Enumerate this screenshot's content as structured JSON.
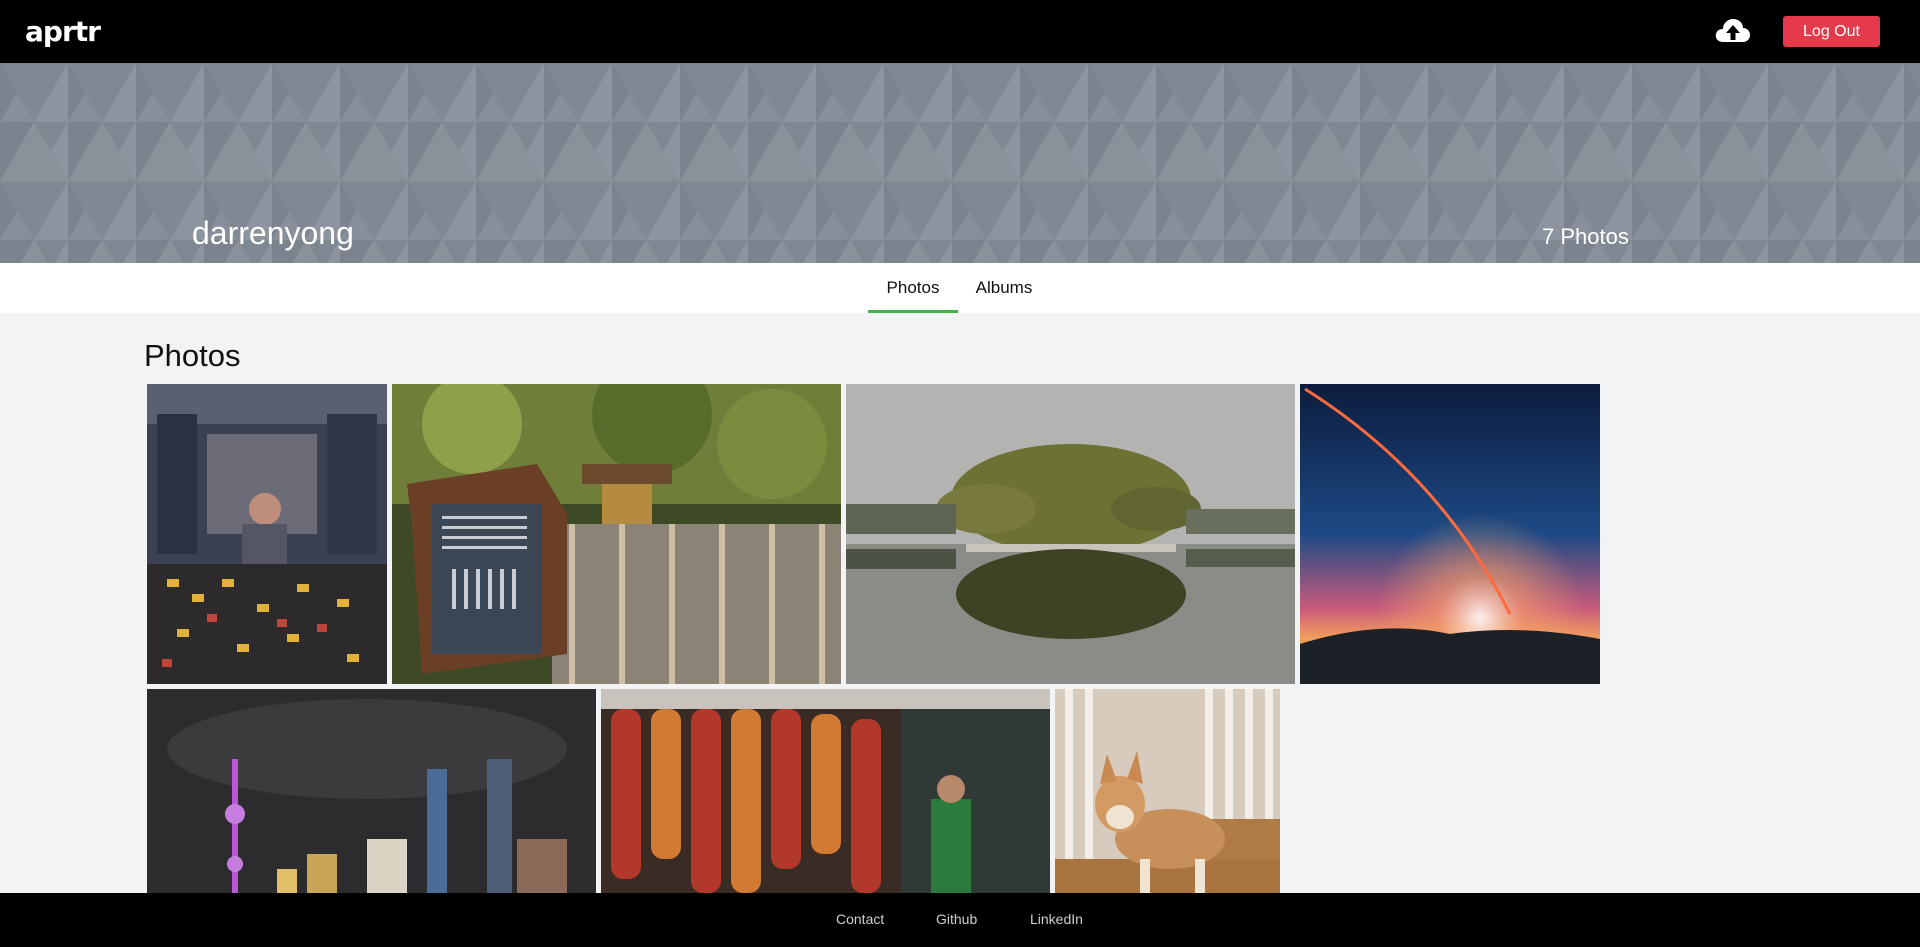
{
  "header": {
    "logo": "aprtr",
    "upload_icon": "cloud-upload-icon",
    "logout_label": "Log Out",
    "logout_color": "#e53a4c"
  },
  "profile": {
    "username": "darrenyong",
    "photo_count": "7 Photos"
  },
  "tabs": [
    {
      "label": "Photos",
      "active": true
    },
    {
      "label": "Albums",
      "active": false
    }
  ],
  "section_title": "Photos",
  "photos": [
    {
      "subject": "shop-keeper-market"
    },
    {
      "subject": "garden-shrine-sign"
    },
    {
      "subject": "lake-tree-reflection"
    },
    {
      "subject": "rocket-launch-night"
    },
    {
      "subject": "city-skyline-night"
    },
    {
      "subject": "hanging-chili-peppers"
    },
    {
      "subject": "shiba-inu-dog"
    }
  ],
  "footer": {
    "links": [
      "Contact",
      "Github",
      "LinkedIn"
    ]
  },
  "colors": {
    "accent": "#3cb54a",
    "banner": "#858c97",
    "background": "#f2f3f5"
  }
}
